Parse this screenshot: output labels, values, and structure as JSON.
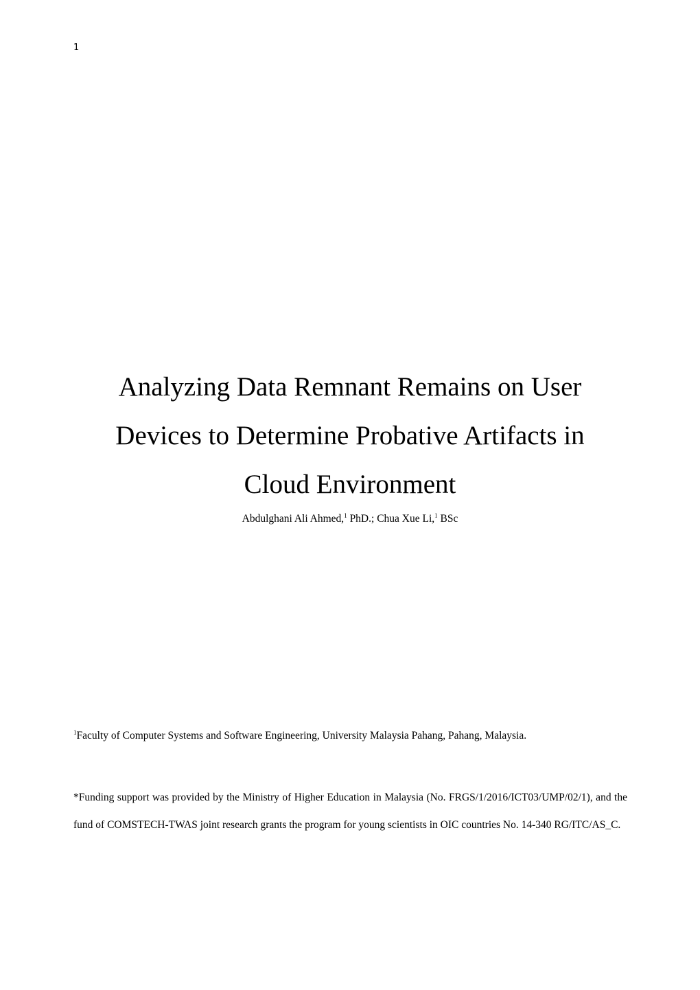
{
  "page": {
    "number": "1"
  },
  "title": {
    "lines": [
      "Analyzing Data Remnant Remains on User",
      "Devices to Determine Probative Artifacts in",
      "Cloud Environment"
    ]
  },
  "authors": [
    {
      "name": "Abdulghani Ali Ahmed,",
      "affiliation_mark": "1",
      "degree": " PhD.;"
    },
    {
      "name": " Chua Xue Li,",
      "affiliation_mark": "1",
      "degree": " BSc"
    }
  ],
  "affiliation": {
    "mark": "1",
    "text": "Faculty of Computer Systems and Software Engineering, University Malaysia Pahang, Pahang, Malaysia."
  },
  "funding": {
    "text": "*Funding support was provided by the Ministry of Higher Education in Malaysia (No. FRGS/1/2016/ICT03/UMP/02/1), and the fund of COMSTECH-TWAS joint research grants the program for young scientists in OIC countries No. 14-340 RG/ITC/AS_C."
  }
}
